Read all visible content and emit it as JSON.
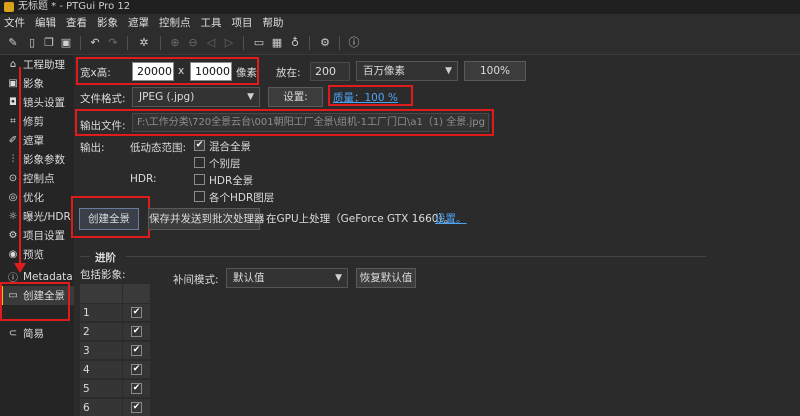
{
  "window": {
    "title": "无标题 * - PTGui Pro 12"
  },
  "menu": [
    "文件",
    "编辑",
    "查看",
    "影象",
    "遮罩",
    "控制点",
    "工具",
    "项目",
    "帮助"
  ],
  "toolbar": {
    "icons": [
      "new-file-icon",
      "open-file-icon",
      "copy-icon",
      "save-icon",
      "undo-icon",
      "redo-icon",
      "settings-icon",
      "zoom-in-icon",
      "zoom-out-icon",
      "previous-icon",
      "next-icon",
      "panorama-editor-icon",
      "table-icon",
      "lightbulb-icon",
      "gear-icon",
      "help-icon"
    ]
  },
  "sidebar": {
    "items": [
      {
        "label": "工程助理",
        "icon": "home-icon"
      },
      {
        "label": "影象",
        "icon": "image-icon"
      },
      {
        "label": "镜头设置",
        "icon": "camera-icon"
      },
      {
        "label": "修剪",
        "icon": "crop-icon"
      },
      {
        "label": "遮罩",
        "icon": "brush-icon"
      },
      {
        "label": "影象参数",
        "icon": "sliders-icon"
      },
      {
        "label": "控制点",
        "icon": "control-points-icon"
      },
      {
        "label": "优化",
        "icon": "optimize-icon"
      },
      {
        "label": "曝光/HDR",
        "icon": "sun-icon"
      },
      {
        "label": "项目设置",
        "icon": "gear-icon"
      },
      {
        "label": "预览",
        "icon": "eye-icon"
      },
      {
        "label": "Metadata",
        "icon": "info-icon"
      },
      {
        "label": "创建全景",
        "icon": "panorama-icon"
      },
      {
        "label": "简易",
        "icon": "chevron-left-circle-icon"
      }
    ],
    "active_index": 12
  },
  "output": {
    "size_label": "宽x高:",
    "width": "20000",
    "times": "x",
    "height": "10000",
    "unit": "像素",
    "scale_label": "放在:",
    "scale_value": "200",
    "megapixel_unit": "百万像素",
    "percent_button": "100%",
    "format_label": "文件格式:",
    "format_value": "JPEG (.jpg)",
    "settings_button": "设置:",
    "quality_link": "质量：100 %",
    "output_file_label": "输出文件:",
    "output_file_path": "F:\\工作分类\\720全景云台\\001朝阳工厂全景\\组机-1工厂门口\\a1（1) 全景.jpg",
    "output_label": "输出:",
    "ldr_label": "低动态范围:",
    "blended_option": "混合全景",
    "individual_layers_option": "个别层",
    "hdr_label": "HDR:",
    "hdr_panorama_option": "HDR全景",
    "hdr_layers_option": "各个HDR图层",
    "create_button": "创建全景",
    "batch_button": "保存并发送到批次处理器",
    "gpu_text": "在GPU上处理（GeForce GTX 1660）。",
    "gpu_settings_link": "设置。"
  },
  "advanced": {
    "title": "进阶",
    "include_images_label": "包括影象:",
    "interpolation_label": "补间模式:",
    "interpolation_value": "默认值",
    "reset_button": "恢复默认值",
    "rows": [
      {
        "num": "1",
        "checked": "✔"
      },
      {
        "num": "2",
        "checked": "✔"
      },
      {
        "num": "3",
        "checked": "✔"
      },
      {
        "num": "4",
        "checked": "✔"
      },
      {
        "num": "5",
        "checked": "✔"
      },
      {
        "num": "6",
        "checked": "✔"
      }
    ]
  },
  "checkbox_states": {
    "blended": "✔",
    "individual": "",
    "hdr": "",
    "hdr_layers": ""
  }
}
